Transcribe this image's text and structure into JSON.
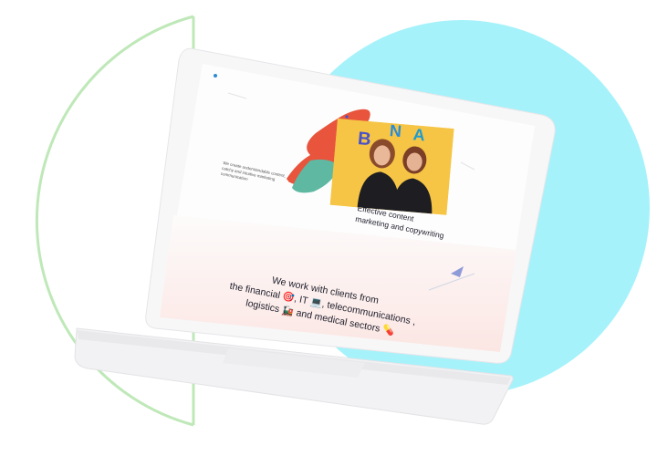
{
  "decor": {
    "circle_color": "#a6f2fb",
    "arc_color": "#bfe8b8"
  },
  "page": {
    "intro_small": "We create understandable content, catchy and intuitive marketing communication",
    "tagline_line1": "Effective content",
    "tagline_line2": "marketing and copywriting",
    "clients_line1": "We work with clients from",
    "clients_line2": "the financial 🎯, IT 💻, telecommunications ,",
    "clients_line3": "logistics 🚂 and medical sectors 💊"
  },
  "hero_image": {
    "letters": [
      "B",
      "N",
      "A"
    ],
    "background_color": "#f6c545"
  }
}
